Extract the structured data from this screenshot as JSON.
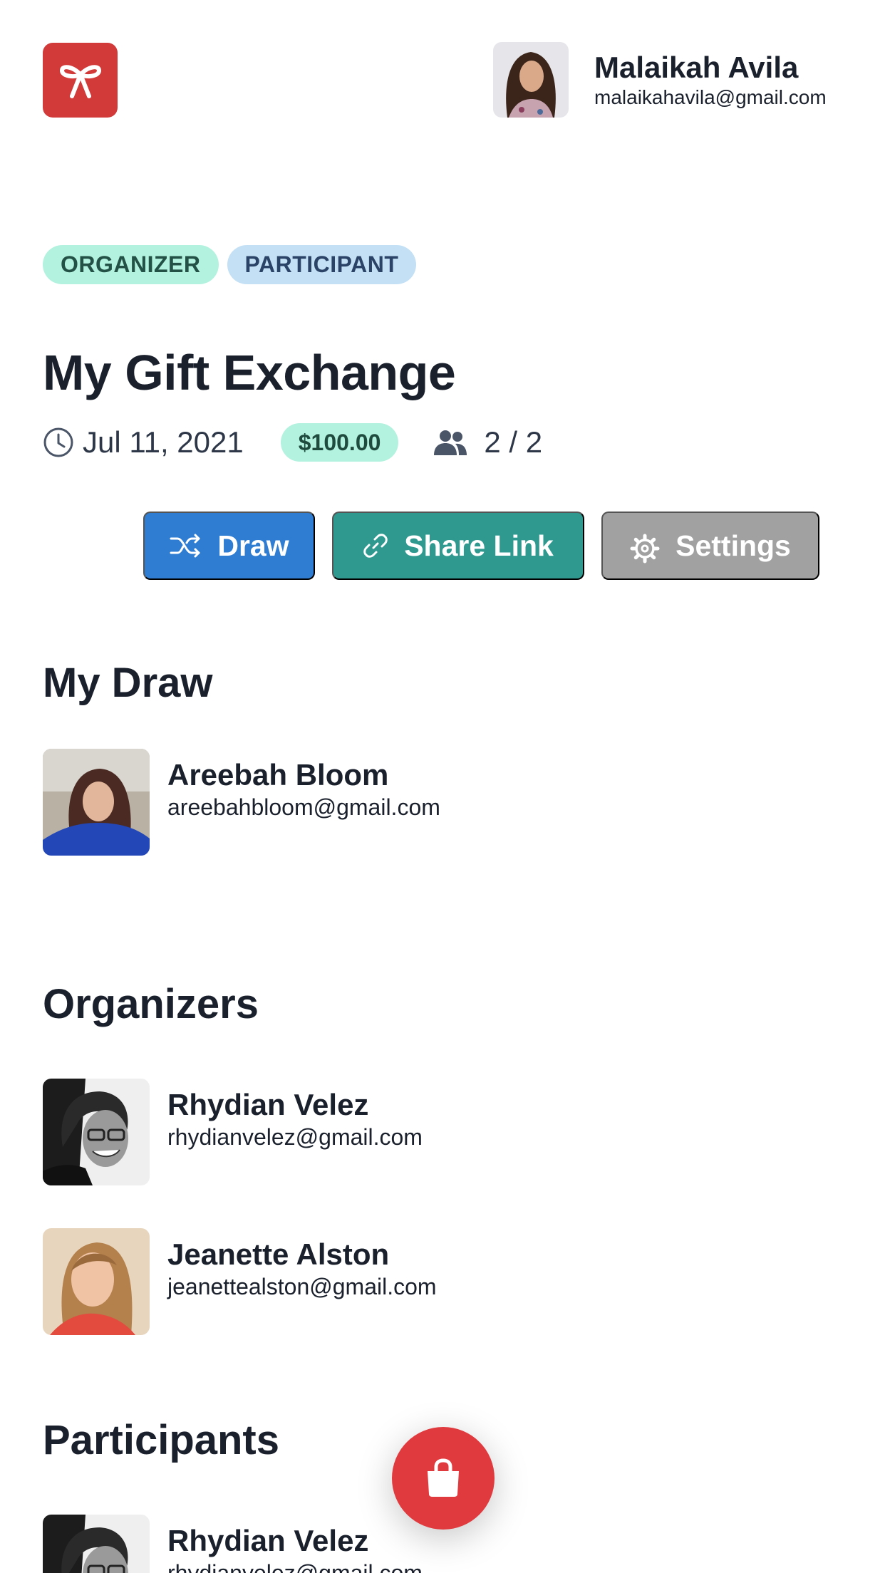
{
  "header": {
    "logo_icon": "bow-icon",
    "user": {
      "name": "Malaikah Avila",
      "email": "malaikahavila@gmail.com"
    }
  },
  "exchange": {
    "badges": [
      "ORGANIZER",
      "PARTICIPANT"
    ],
    "title": "My Gift Exchange",
    "date": "Jul 11, 2021",
    "budget": "$100.00",
    "participant_count": "2 / 2"
  },
  "actions": {
    "draw_label": "Draw",
    "share_label": "Share Link",
    "settings_label": "Settings"
  },
  "my_draw": {
    "title": "My Draw",
    "person": {
      "name": "Areebah Bloom",
      "email": "areebahbloom@gmail.com"
    }
  },
  "organizers": {
    "title": "Organizers",
    "people": [
      {
        "name": "Rhydian Velez",
        "email": "rhydianvelez@gmail.com"
      },
      {
        "name": "Jeanette Alston",
        "email": "jeanettealston@gmail.com"
      }
    ]
  },
  "participants": {
    "title": "Participants",
    "people": [
      {
        "name": "Rhydian Velez",
        "email": "rhydianvelez@gmail.com"
      }
    ]
  },
  "fab": {
    "icon": "shopping-bag-icon"
  },
  "colors": {
    "brand_red": "#d23a3a",
    "draw_blue": "#2e7dd2",
    "share_teal": "#2f9990",
    "settings_gray": "#a1a1a1",
    "badge_green": "#b2f2de",
    "badge_blue": "#c3e0f5",
    "fab_red": "#e03a3e"
  }
}
